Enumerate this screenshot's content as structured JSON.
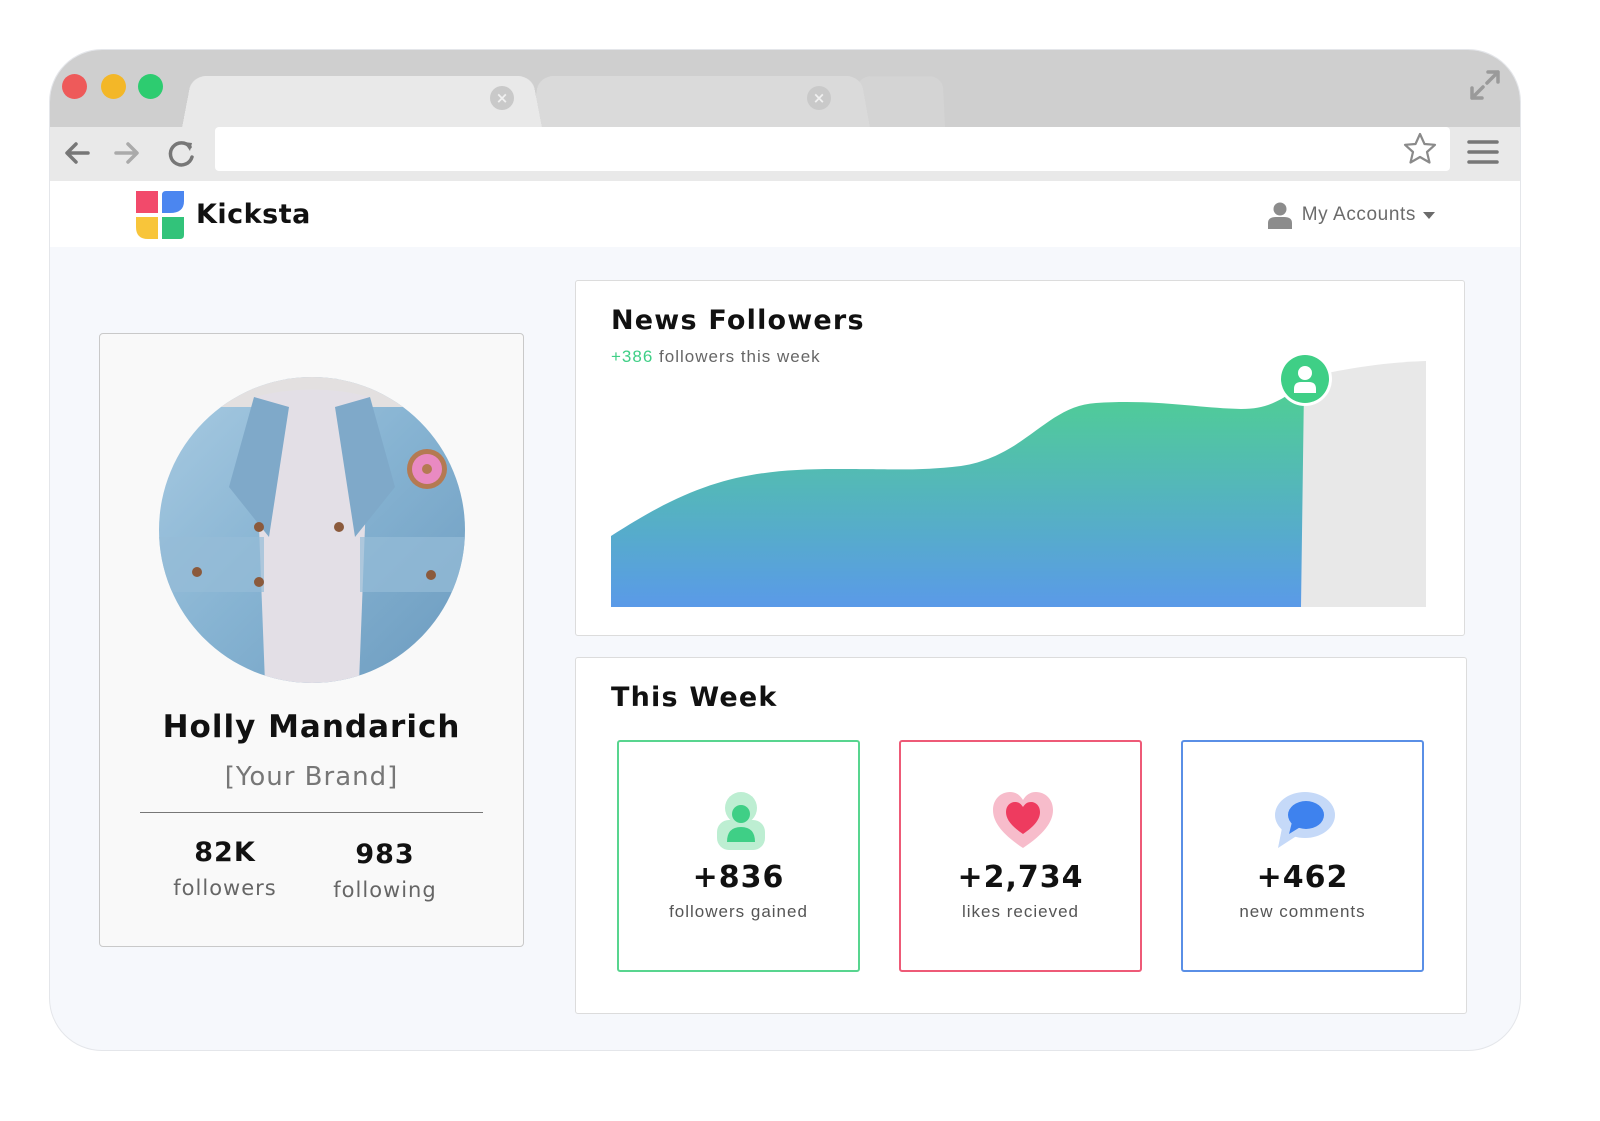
{
  "app": {
    "brand": "Kicksta",
    "accounts_label": "My Accounts"
  },
  "browser": {
    "icons": [
      "back-arrow-icon",
      "forward-arrow-icon",
      "reload-icon",
      "star-icon",
      "hamburger-menu-icon",
      "expand-icon"
    ]
  },
  "profile": {
    "name": "Holly Mandarich",
    "brand": "[Your Brand]",
    "followers_value": "82K",
    "followers_label": "followers",
    "following_value": "983",
    "following_label": "following"
  },
  "followers_chart": {
    "title": "News Followers",
    "delta": "+386",
    "delta_suffix": " followers this week"
  },
  "this_week": {
    "title": "This Week",
    "tiles": [
      {
        "value": "+836",
        "label": "followers gained",
        "icon": "person-icon",
        "color": "#58d58f"
      },
      {
        "value": "+2,734",
        "label": "likes recieved",
        "icon": "heart-icon",
        "color": "#ee5a77"
      },
      {
        "value": "+462",
        "label": "new comments",
        "icon": "speech-bubble-icon",
        "color": "#5a8fe6"
      }
    ]
  },
  "colors": {
    "accent_green": "#3fcf86",
    "accent_red": "#ee5a77",
    "accent_blue": "#5a8fe6",
    "chart_top": "#4fcf93",
    "chart_bottom": "#5a9ae8"
  }
}
